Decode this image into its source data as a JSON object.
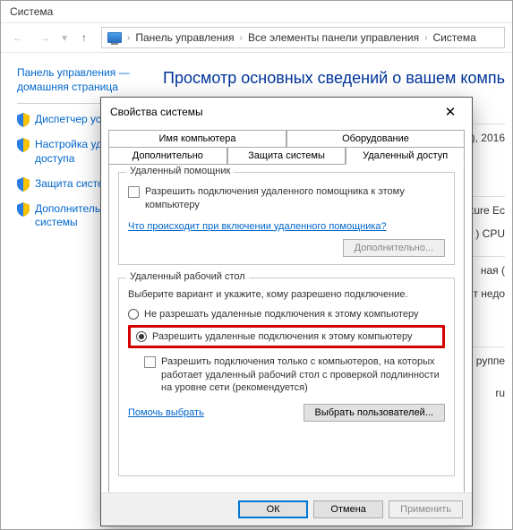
{
  "parent": {
    "title": "Система",
    "breadcrumbs": [
      "Панель управления",
      "Все элементы панели управления",
      "Система"
    ],
    "home_link": "Панель управления — домашняя страница",
    "sidebar": [
      "Диспетчер устр",
      "Настройка удал\nдоступа",
      "Защита системы",
      "Дополнительны\nсистемы"
    ],
    "main_heading": "Просмотр основных сведений о вашем компь",
    "right_fragments": [
      "), 2016",
      "ture Ec",
      ") CPU",
      "ная (",
      "т недо",
      "руппе",
      "ru"
    ]
  },
  "dialog": {
    "title": "Свойства системы",
    "tabs_top": [
      "Имя компьютера",
      "Оборудование"
    ],
    "tabs_bottom": [
      "Дополнительно",
      "Защита системы",
      "Удаленный доступ"
    ],
    "assistant": {
      "group_title": "Удаленный помощник",
      "checkbox": "Разрешить подключения удаленного помощника к этому компьютеру",
      "link": "Что происходит при включении удаленного помощника?",
      "advanced_btn": "Дополнительно..."
    },
    "rdp": {
      "group_title": "Удаленный рабочий стол",
      "desc": "Выберите вариант и укажите, кому разрешено подключение.",
      "opt_deny": "Не разрешать удаленные подключения к этому компьютеру",
      "opt_allow": "Разрешить удаленные подключения к этому компьютеру",
      "nla_checkbox": "Разрешить подключения только с компьютеров, на которых работает удаленный рабочий стол с проверкой подлинности на уровне сети (рекомендуется)",
      "help_link": "Помочь выбрать",
      "select_users_btn": "Выбрать пользователей..."
    },
    "buttons": {
      "ok": "ОК",
      "cancel": "Отмена",
      "apply": "Применить"
    }
  }
}
